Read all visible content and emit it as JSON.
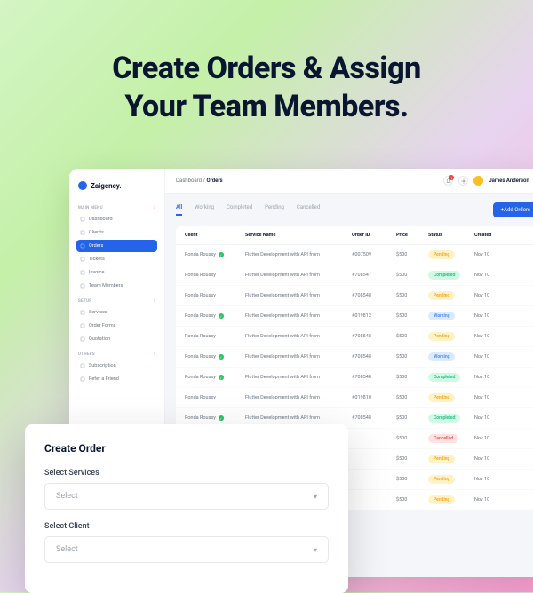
{
  "hero": {
    "line1": "Create Orders & Assign",
    "line2": "Your Team Members."
  },
  "brand": {
    "name": "Zaigency."
  },
  "sidebar": {
    "sections": [
      {
        "label": "MAIN MENU",
        "items": [
          {
            "label": "Dashboard",
            "icon": "grid"
          },
          {
            "label": "Clients",
            "icon": "users"
          },
          {
            "label": "Orders",
            "icon": "clipboard",
            "active": true
          },
          {
            "label": "Tickets",
            "icon": "ticket"
          },
          {
            "label": "Invoice",
            "icon": "file"
          },
          {
            "label": "Team Members",
            "icon": "team"
          }
        ]
      },
      {
        "label": "SETUP",
        "items": [
          {
            "label": "Services",
            "icon": "gear"
          },
          {
            "label": "Order Forms",
            "icon": "form"
          },
          {
            "label": "Quotation",
            "icon": "quote"
          }
        ]
      },
      {
        "label": "OTHERS",
        "items": [
          {
            "label": "Subscription",
            "icon": "sub"
          },
          {
            "label": "Refer a Friend",
            "icon": "refer"
          }
        ]
      }
    ]
  },
  "breadcrumb": {
    "parent": "Dashboard",
    "current": "Orders"
  },
  "user": {
    "name": "James Anderson",
    "notifications": "1"
  },
  "tabs": [
    "All",
    "Working",
    "Completed",
    "Pending",
    "Cancelled"
  ],
  "addButton": "+Add Orders",
  "table": {
    "headers": {
      "client": "Client",
      "service": "Service Name",
      "orderid": "Order ID",
      "price": "Price",
      "status": "Status",
      "created": "Created"
    },
    "rows": [
      {
        "client": "Ronda Roussy",
        "verified": true,
        "service": "Flutter Development with API from",
        "orderid": "#007509",
        "price": "$500",
        "status": "Pending",
        "statusClass": "pending",
        "created": "Nov 10"
      },
      {
        "client": "Ronda Roussy",
        "verified": false,
        "service": "Flutter Development with API from",
        "orderid": "#708547",
        "price": "$500",
        "status": "Completed",
        "statusClass": "completed",
        "created": "Nov 10"
      },
      {
        "client": "Ronda Roussy",
        "verified": false,
        "service": "Flutter Development with API from",
        "orderid": "#708548",
        "price": "$500",
        "status": "Pending",
        "statusClass": "pending",
        "created": "Nov 10"
      },
      {
        "client": "Ronda Roussy",
        "verified": true,
        "service": "Flutter Development with API from",
        "orderid": "#019812",
        "price": "$500",
        "status": "Working",
        "statusClass": "working",
        "created": "Nov 10"
      },
      {
        "client": "Ronda Roussy",
        "verified": false,
        "service": "Flutter Development with API from",
        "orderid": "#708548",
        "price": "$500",
        "status": "Pending",
        "statusClass": "pending",
        "created": "Nov 10"
      },
      {
        "client": "Ronda Roussy",
        "verified": true,
        "service": "Flutter Development with API from",
        "orderid": "#708548",
        "price": "$500",
        "status": "Working",
        "statusClass": "working",
        "created": "Nov 10"
      },
      {
        "client": "Ronda Roussy",
        "verified": true,
        "service": "Flutter Development with API from",
        "orderid": "#708548",
        "price": "$500",
        "status": "Completed",
        "statusClass": "completed",
        "created": "Nov 10"
      },
      {
        "client": "Ronda Roussy",
        "verified": false,
        "service": "Flutter Development with API from",
        "orderid": "#019810",
        "price": "$500",
        "status": "Pending",
        "statusClass": "pending",
        "created": "Nov 10"
      },
      {
        "client": "Ronda Roussy",
        "verified": true,
        "service": "Flutter Development with API from",
        "orderid": "#708548",
        "price": "$500",
        "status": "Completed",
        "statusClass": "completed",
        "created": "Nov 10"
      },
      {
        "client": "",
        "verified": false,
        "service": "",
        "orderid": "",
        "price": "$500",
        "status": "Cancelled",
        "statusClass": "cancelled",
        "created": "Nov 10"
      },
      {
        "client": "",
        "verified": false,
        "service": "",
        "orderid": "",
        "price": "$500",
        "status": "Pending",
        "statusClass": "pending",
        "created": "Nov 10"
      },
      {
        "client": "",
        "verified": false,
        "service": "",
        "orderid": "",
        "price": "$500",
        "status": "Pending",
        "statusClass": "pending",
        "created": "Nov 10"
      },
      {
        "client": "",
        "verified": false,
        "service": "",
        "orderid": "",
        "price": "$500",
        "status": "Pending",
        "statusClass": "pending",
        "created": "Nov 10"
      }
    ]
  },
  "modal": {
    "title": "Create Order",
    "fields": {
      "services": {
        "label": "Select Services",
        "placeholder": "Select"
      },
      "client": {
        "label": "Select Client",
        "placeholder": "Select"
      }
    }
  }
}
